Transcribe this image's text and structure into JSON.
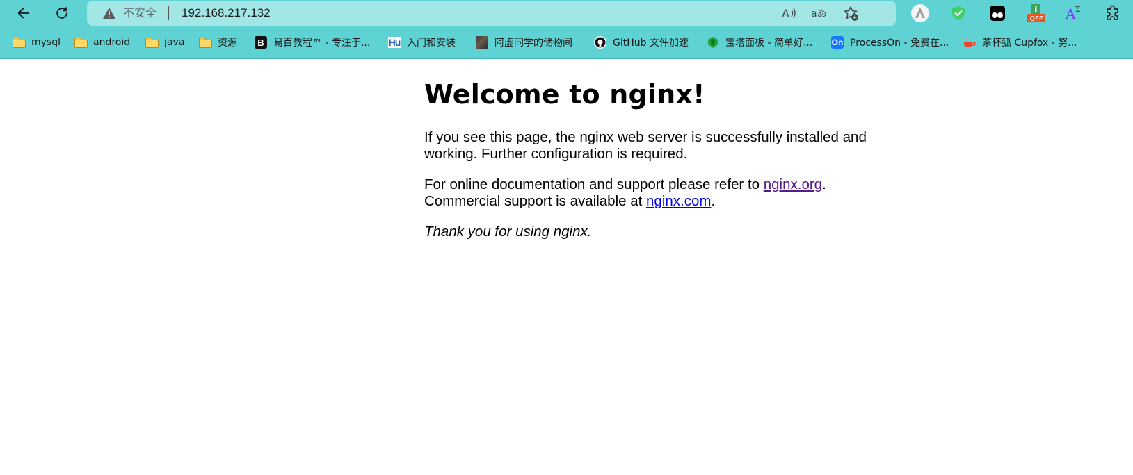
{
  "browser": {
    "nav": {
      "back_icon": "back-arrow-icon",
      "reload_icon": "reload-icon"
    },
    "address_bar": {
      "security_label": "不安全",
      "url": "192.168.217.132",
      "warning_icon": "warning-triangle-icon",
      "read_aloud_icon": "read-aloud-icon",
      "translate_icon": "translate-icon",
      "favorite_icon": "add-favorite-icon"
    },
    "extensions": [
      {
        "name": "a-extension-icon"
      },
      {
        "name": "shield-check-extension-icon"
      },
      {
        "name": "tampermonkey-extension-icon"
      },
      {
        "name": "off-extension-icon",
        "badge": "OFF"
      },
      {
        "name": "font-a-extension-icon"
      },
      {
        "name": "extensions-puzzle-icon"
      }
    ],
    "bookmarks": [
      {
        "label": "mysql",
        "icon": "folder-icon"
      },
      {
        "label": "android",
        "icon": "folder-icon"
      },
      {
        "label": "java",
        "icon": "folder-icon"
      },
      {
        "label": "资源",
        "icon": "folder-icon"
      },
      {
        "label": "易百教程™ - 专注于...",
        "icon": "b-favicon-icon"
      },
      {
        "label": "入门和安装",
        "icon": "hu-favicon-icon"
      },
      {
        "label": "阿虚同学的储物间",
        "icon": "photo-favicon-icon"
      },
      {
        "label": "GitHub 文件加速",
        "icon": "github-favicon-icon"
      },
      {
        "label": "宝塔面板 - 简单好...",
        "icon": "baota-favicon-icon"
      },
      {
        "label": "ProcessOn - 免费在...",
        "icon": "processon-favicon-icon"
      },
      {
        "label": "茶杯狐 Cupfox - 努...",
        "icon": "cupfox-favicon-icon"
      }
    ],
    "colors": {
      "chrome": "#5fd3d3",
      "omnibox": "#a3e6e6"
    }
  },
  "page": {
    "heading": "Welcome to nginx!",
    "p1": "If you see this page, the nginx web server is successfully installed and working. Further configuration is required.",
    "p2_text1": "For online documentation and support please refer to ",
    "p2_link1": "nginx.org",
    "p2_text2": ".",
    "p2_text3": "Commercial support is available at ",
    "p2_link2": "nginx.com",
    "p2_text4": ".",
    "p3": "Thank you for using nginx."
  }
}
